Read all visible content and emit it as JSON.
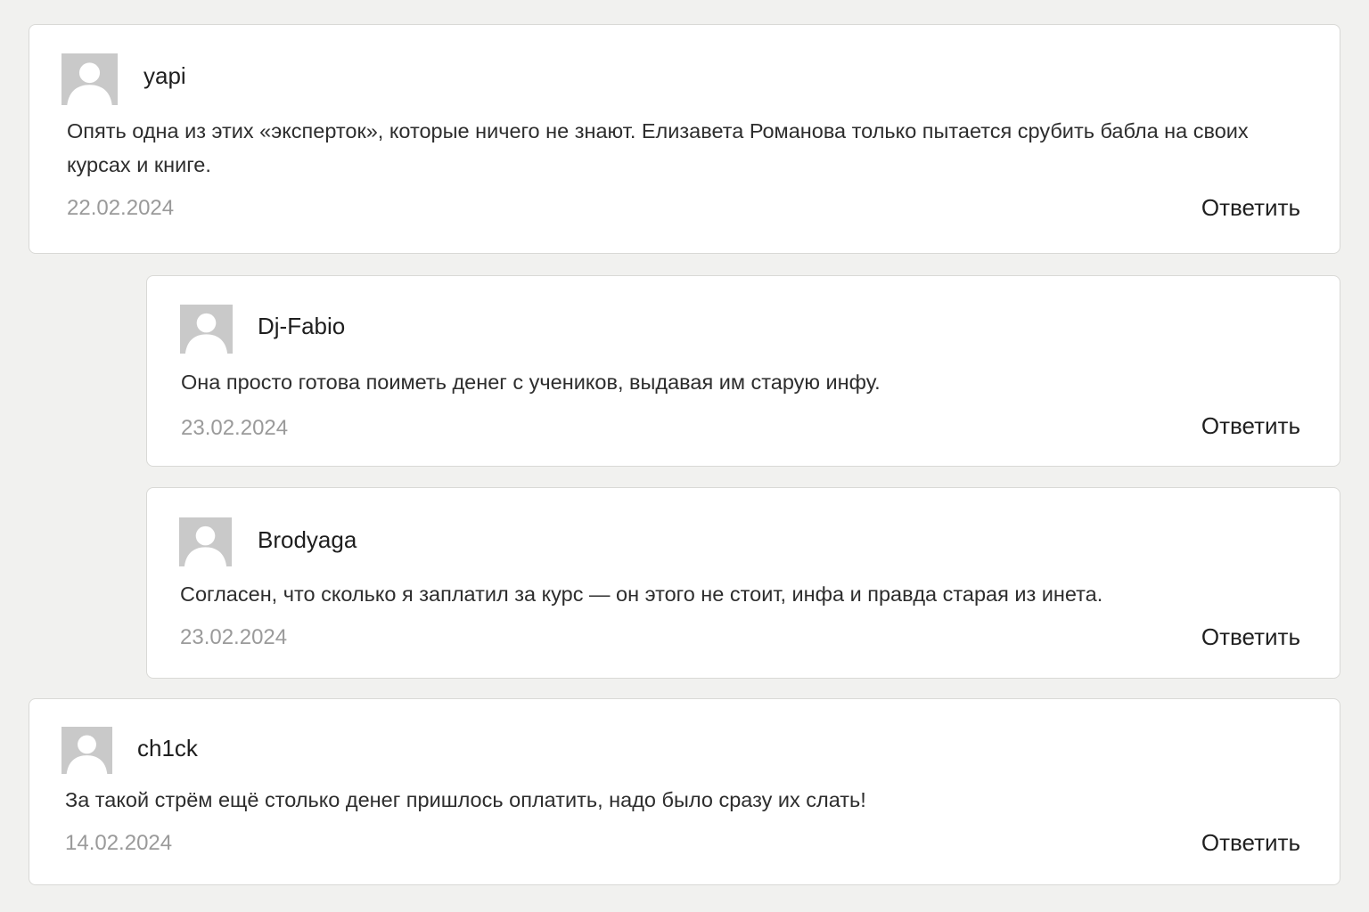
{
  "comments": [
    {
      "author": "yapi",
      "text": "Опять одна из этих «эксперток», которые ничего не знают. Елизавета Романова только пытается срубить бабла на своих курсах и книге.",
      "date": "22.02.2024",
      "reply_label": "Ответить",
      "avatar_icon": "user-placeholder-icon"
    },
    {
      "author": "Dj-Fabio",
      "text": "Она просто готова поиметь денег с учеников, выдавая им старую инфу.",
      "date": "23.02.2024",
      "reply_label": "Ответить",
      "avatar_icon": "user-placeholder-icon"
    },
    {
      "author": "Brodyaga",
      "text": "Согласен, что сколько я заплатил за курс — он этого не стоит, инфа и правда старая из инета.",
      "date": "23.02.2024",
      "reply_label": "Ответить",
      "avatar_icon": "user-placeholder-icon"
    },
    {
      "author": "ch1ck",
      "text": "За такой стрём ещё столько денег пришлось оплатить, надо было сразу их слать!",
      "date": "14.02.2024",
      "reply_label": "Ответить",
      "avatar_icon": "user-placeholder-icon"
    }
  ],
  "colors": {
    "page_background": "#f1f1ef",
    "card_background": "#ffffff",
    "card_border": "#d9d9d6",
    "avatar_background": "#c9c9c9",
    "date_text": "#9a9a9a"
  }
}
